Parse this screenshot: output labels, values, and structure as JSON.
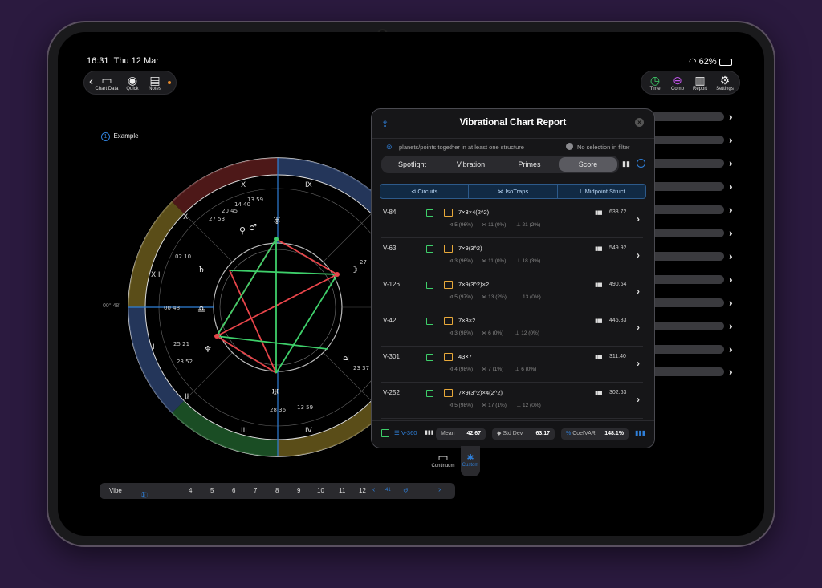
{
  "status": {
    "time": "16:31",
    "date": "Thu 12 Mar",
    "battery": "62%"
  },
  "toolbar_left": [
    {
      "label": "Chart Data",
      "icon": "folder-icon"
    },
    {
      "label": "Quick",
      "icon": "circle-icon"
    },
    {
      "label": "Notes",
      "icon": "notes-icon"
    }
  ],
  "toolbar_right": [
    {
      "label": "Time",
      "icon": "clock-icon"
    },
    {
      "label": "Comp",
      "icon": "comp-icon"
    },
    {
      "label": "Report",
      "icon": "report-icon"
    },
    {
      "label": "Settings",
      "icon": "gear-icon"
    }
  ],
  "chart": {
    "example_badge": "1",
    "example_label": "Example",
    "houses": [
      "X",
      "IX",
      "XI",
      "XII",
      "I",
      "II",
      "III",
      "IV"
    ],
    "degree_label": "00° 48'",
    "planet_labels": [
      "27 53",
      "20 45",
      "14 40",
      "13 59",
      "00 48",
      "02 10",
      "25 21",
      "23 52",
      "28 36",
      "13 59",
      "23 37",
      "27"
    ]
  },
  "report": {
    "title": "Vibrational Chart Report",
    "filter_text": "planets/points together in at least one structure",
    "no_selection": "No selection in filter",
    "tabs": [
      "Spotlight",
      "Vibration",
      "Primes",
      "Score"
    ],
    "selected_tab": "Score",
    "subtabs": [
      "⊲ Circuits",
      "⋈ IsoTraps",
      "⊥ Midpoint Struct"
    ],
    "rows": [
      {
        "id": "V-84",
        "formula": "7×3×4(2^2)",
        "stats": "⊲ 5 (96%)      ⋈ 11 (0%)       ⊥ 21 (2%)",
        "score": "638.72"
      },
      {
        "id": "V-63",
        "formula": "7×9(3^2)",
        "stats": "⊲ 3 (96%)      ⋈ 11 (0%)       ⊥ 18 (3%)",
        "score": "549.92"
      },
      {
        "id": "V-126",
        "formula": "7×9(3^2)×2",
        "stats": "⊲ 5 (97%)      ⋈ 13 (2%)       ⊥ 13 (0%)",
        "score": "490.64"
      },
      {
        "id": "V-42",
        "formula": "7×3×2",
        "stats": "⊲ 3 (98%)      ⋈ 6 (0%)        ⊥ 12 (0%)",
        "score": "446.83"
      },
      {
        "id": "V-301",
        "formula": "43×7",
        "stats": "⊲ 4 (98%)      ⋈ 7 (1%)        ⊥ 6 (0%)",
        "score": "311.40"
      },
      {
        "id": "V-252",
        "formula": "7×9(3^2)×4(2^2)",
        "stats": "⊲ 5 (98%)      ⋈ 17 (1%)       ⊥ 12 (0%)",
        "score": "302.63"
      }
    ],
    "footer": {
      "range": "V-360",
      "mean_label": "Mean",
      "mean": "42.67",
      "std_label": "Std Dev",
      "std": "63.17",
      "cv_label": "CoefVAR",
      "cv": "148.1%"
    }
  },
  "bottom_tabs": [
    "Continuum",
    "Custom"
  ],
  "vibe_bar": {
    "label": "Vibe",
    "selected": "1",
    "numbers": [
      "4",
      "5",
      "6",
      "7",
      "8",
      "9",
      "10",
      "11",
      "12"
    ],
    "nav_value": "41"
  },
  "colors": {
    "accent": "#2f7fd8",
    "green": "#3ecf6a",
    "red": "#e8454a",
    "orange": "#e8a93a"
  }
}
